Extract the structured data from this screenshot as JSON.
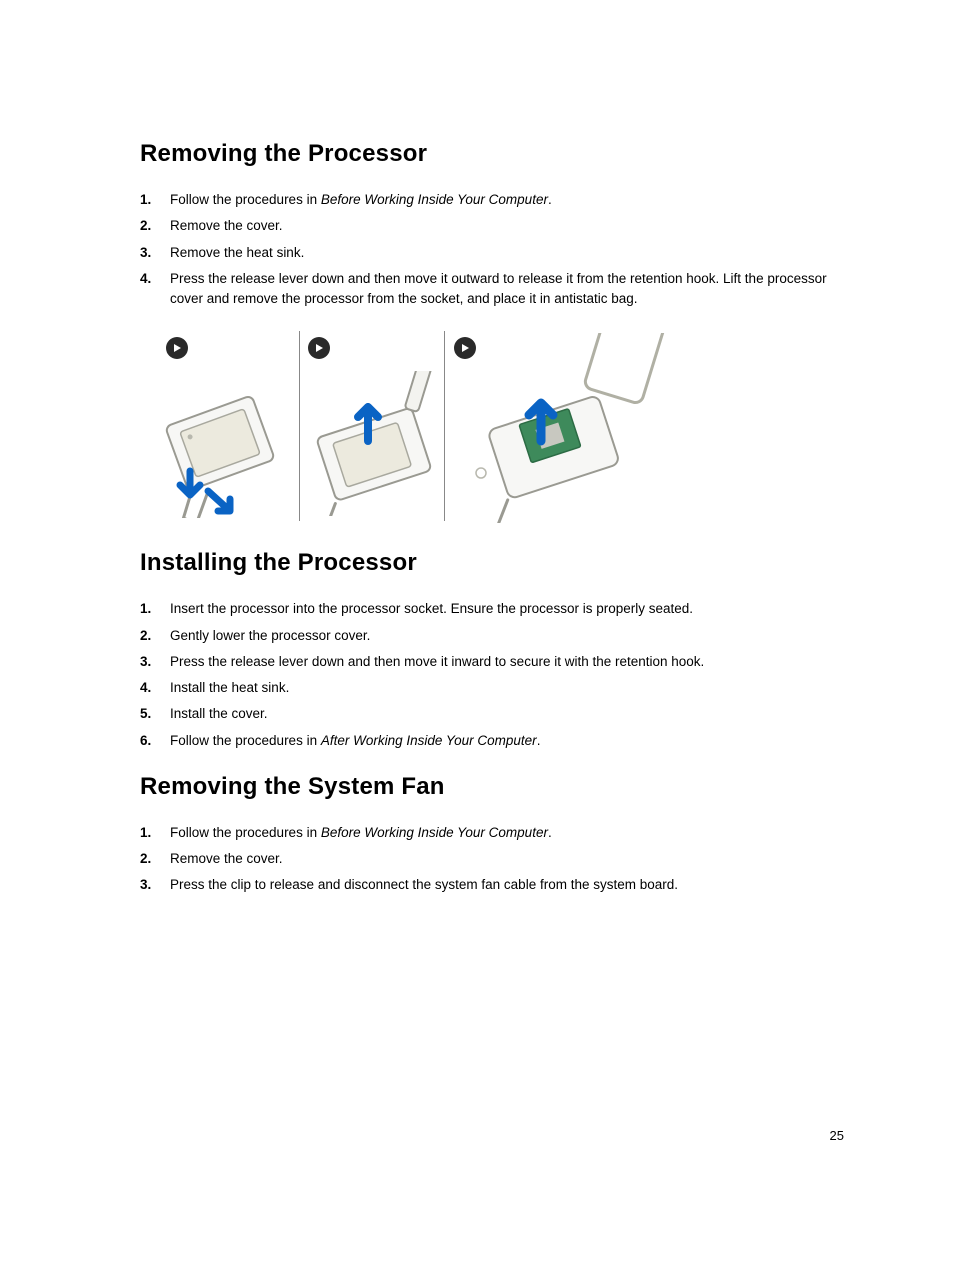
{
  "sections": [
    {
      "heading": "Removing the Processor",
      "steps": [
        {
          "prefix": "Follow the procedures in ",
          "italic": "Before Working Inside Your Computer",
          "suffix": "."
        },
        {
          "text": "Remove the cover."
        },
        {
          "text": "Remove the heat sink."
        },
        {
          "text": "Press the release lever down and then move it outward to release it from the retention hook. Lift the processor cover and remove the processor from the socket, and place it in antistatic bag."
        }
      ],
      "hasIllustration": true
    },
    {
      "heading": "Installing the Processor",
      "steps": [
        {
          "text": "Insert the processor into the processor socket. Ensure the processor is properly seated."
        },
        {
          "text": "Gently lower the processor cover."
        },
        {
          "text": "Press the release lever down and then move it inward to secure it with the retention hook."
        },
        {
          "text": "Install the heat sink."
        },
        {
          "text": "Install the cover."
        },
        {
          "prefix": "Follow the procedures in ",
          "italic": "After Working Inside Your Computer",
          "suffix": "."
        }
      ],
      "hasIllustration": false
    },
    {
      "heading": "Removing the System Fan",
      "steps": [
        {
          "prefix": "Follow the procedures in ",
          "italic": "Before Working Inside Your Computer",
          "suffix": "."
        },
        {
          "text": "Remove the cover."
        },
        {
          "text": "Press the clip to release and disconnect the system fan cable from the system board."
        }
      ],
      "hasIllustration": false
    }
  ],
  "pageNumber": "25"
}
